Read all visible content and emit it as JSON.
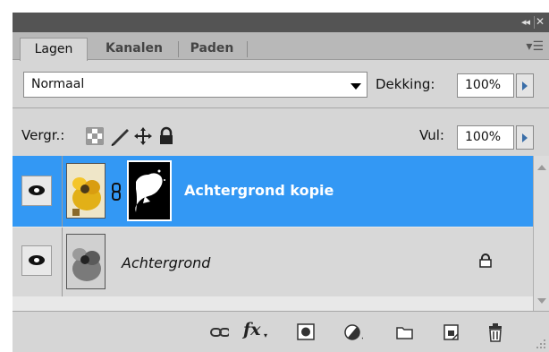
{
  "titlebar": {
    "collapse_icon": "double-chevron-right-icon",
    "close_icon": "close-icon"
  },
  "tabs": [
    {
      "label": "Lagen",
      "active": true
    },
    {
      "label": "Kanalen",
      "active": false
    },
    {
      "label": "Paden",
      "active": false
    }
  ],
  "panel_menu_icon": "panel-menu-icon",
  "blend_mode": {
    "value": "Normaal"
  },
  "opacity": {
    "label": "Dekking:",
    "value": "100%"
  },
  "lock": {
    "label": "Vergr.:",
    "icons": [
      "lock-transparency-icon",
      "lock-pixels-icon",
      "lock-position-icon",
      "lock-all-icon"
    ]
  },
  "fill": {
    "label": "Vul:",
    "value": "100%"
  },
  "layers": [
    {
      "name": "Achtergrond kopie",
      "selected": true,
      "visible": true,
      "has_mask": true,
      "locked": false
    },
    {
      "name": "Achtergrond",
      "selected": false,
      "visible": true,
      "has_mask": false,
      "locked": true
    }
  ],
  "bottom_icons": [
    "link-layers-icon",
    "fx-icon",
    "add-mask-icon",
    "adjustment-layer-icon",
    "new-group-icon",
    "new-layer-icon",
    "delete-layer-icon"
  ],
  "bottom_fx_text": "fx",
  "colors": {
    "selection": "#3398f4",
    "panel_bg": "#d6d6d6",
    "titlebar": "#545454"
  }
}
